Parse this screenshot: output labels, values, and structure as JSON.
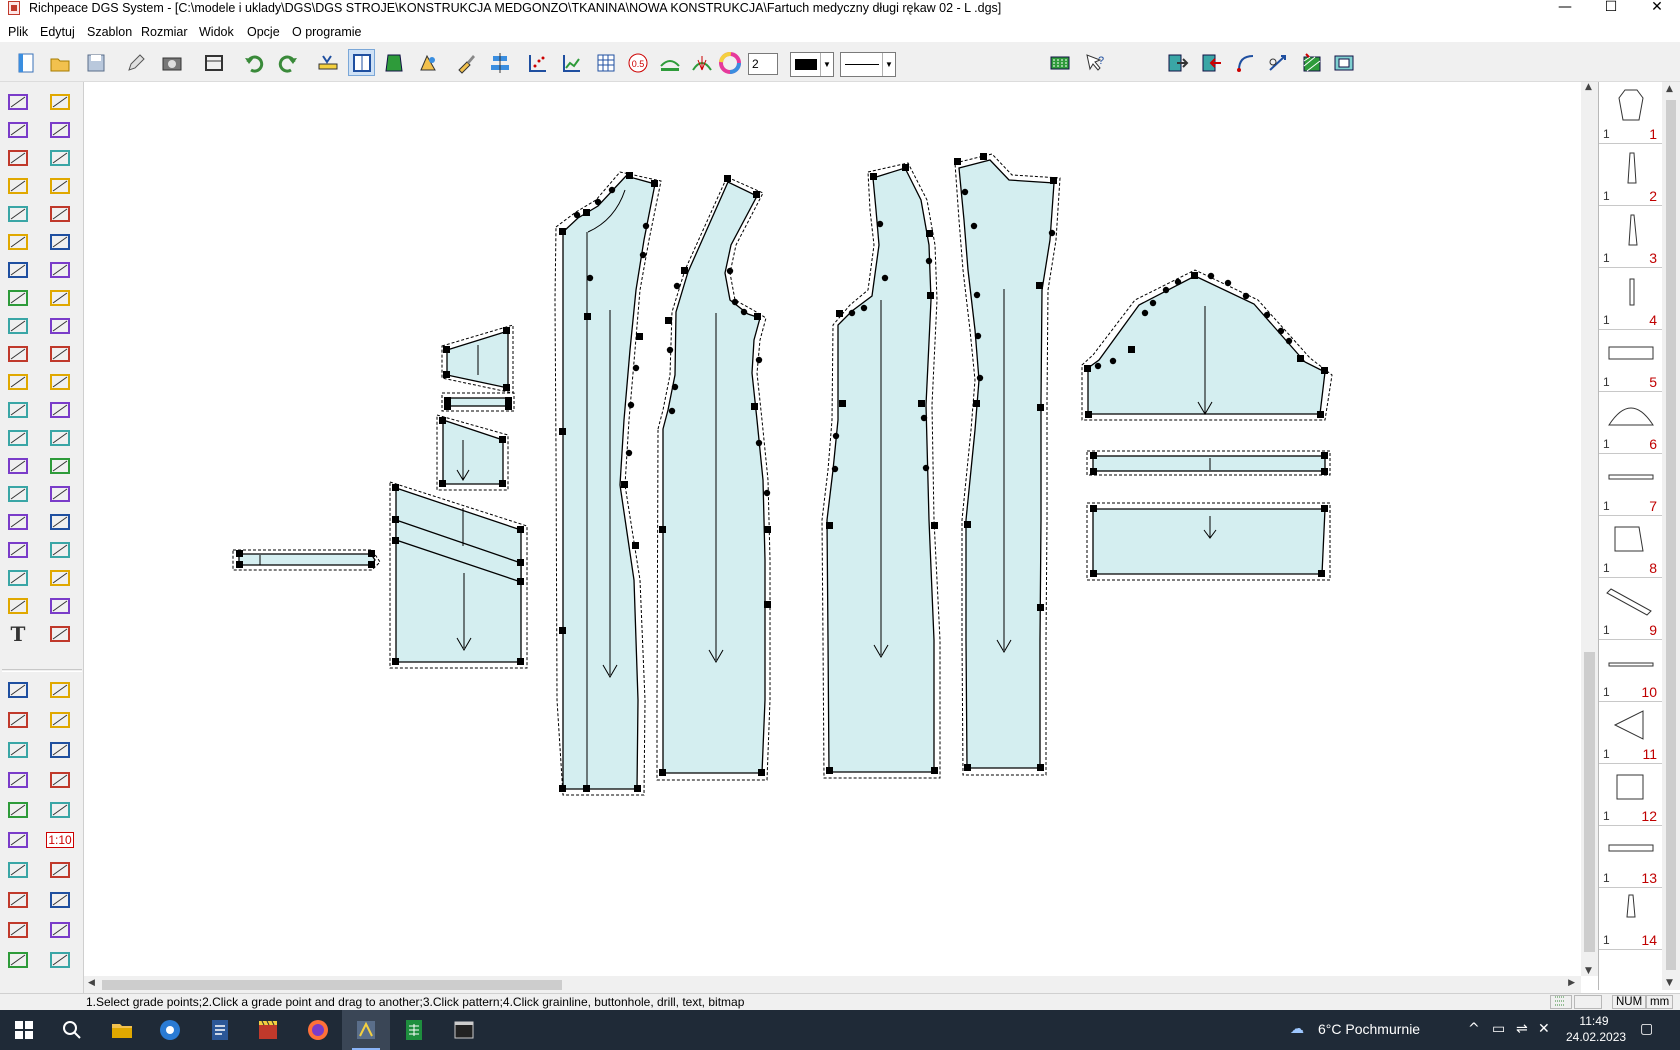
{
  "window": {
    "title": "Richpeace DGS System - [C:\\modele i uklady\\DGS\\DGS STROJE\\KONSTRUKCJA MEDGONZO\\TKANINA\\NOWA KONSTRUKCJA\\Fartuch medyczny długi rękaw 02 -  L .dgs]",
    "minimize": "—",
    "maximize": "☐",
    "close": "✕"
  },
  "menu": [
    "Plik",
    "Edytuj",
    "Szablon",
    "Rozmiar",
    "Widok",
    "Opcje",
    "O programie"
  ],
  "toolbar": {
    "line_width_value": "2",
    "pen_color": "#000000",
    "icons": [
      "new-file-icon",
      "open-folder-icon",
      "save-icon",
      "edit-pencil-icon",
      "camera-icon",
      "print-frame-icon",
      "undo-icon",
      "redo-icon",
      "ruler-grade-icon",
      "pattern-view-icon",
      "fill-piece-icon",
      "piece-tools-icon",
      "brush-icon",
      "align-icon",
      "grade-points-icon",
      "curve-chart-icon",
      "grid-table-icon",
      "scale-0-5-icon",
      "measure-curve-icon",
      "fan-curve-icon",
      "color-wheel-icon",
      "marker-icon",
      "help-icon",
      "export-icon",
      "import-icon",
      "curve-tool-icon",
      "rotate-tool-icon",
      "hatch-icon",
      "frame-icon"
    ]
  },
  "left_tools": {
    "icons": [
      "select-arrow-icon",
      "select-box-icon",
      "pencil-icon",
      "pocket-icon",
      "rectangle-icon",
      "notch-icon",
      "point-line-icon",
      "fold-icon",
      "cross-point-icon",
      "duplicate-piece-icon",
      "link-icon",
      "measure-icon",
      "compass-icon",
      "button-icon",
      "scissors-icon",
      "grid-piece-icon",
      "ruler-icon",
      "rotate-piece-icon",
      "bag-icon",
      "sew-icon",
      "book-icon",
      "dart-icon",
      "grade-icon",
      "paint-bucket-icon",
      "flare-icon",
      "split-icon",
      "spiral-icon",
      "transfer-icon",
      "dart-rotate-icon",
      "mirror-icon",
      "bridge-icon",
      "stretch-icon",
      "scissors-cut-icon",
      "pleat-icon",
      "dashed-line-icon",
      "seam-icon",
      "list-icon",
      "fill-pattern-icon",
      "text-tool-icon",
      "pleat-fan-icon"
    ],
    "icons2": [
      "parallelogram-icon",
      "protractor-icon",
      "trapezoid-icon",
      "curve-edit-icon",
      "angle-icon",
      "measure-angle-icon",
      "square-point-icon",
      "arc-icon",
      "symmetry-icon",
      "piece-arrow-icon",
      "h-line-icon",
      "scale-1-10-icon",
      "double-line-icon",
      "label-tag-icon",
      "step-line-icon",
      "outline-piece-icon",
      "node-line-icon",
      "smooth-curve-icon",
      "triangle-ruler-icon",
      "table-icon"
    ],
    "scale_label": "1:10",
    "text_tool_label": "T"
  },
  "canvas": {
    "fill_color": "#d4eef0",
    "pieces": [
      "front-piece",
      "front-side-piece",
      "back-side-piece",
      "back-piece",
      "sleeve-piece",
      "cuff-strip-piece",
      "cuff-piece",
      "pocket-piece",
      "pocket-top-piece",
      "small-pocket-piece",
      "collar-piece",
      "belt-strip-piece"
    ]
  },
  "piece_panel": {
    "items": [
      {
        "qty": "1",
        "num": "1"
      },
      {
        "qty": "1",
        "num": "2"
      },
      {
        "qty": "1",
        "num": "3"
      },
      {
        "qty": "1",
        "num": "4"
      },
      {
        "qty": "1",
        "num": "5"
      },
      {
        "qty": "1",
        "num": "6"
      },
      {
        "qty": "1",
        "num": "7"
      },
      {
        "qty": "1",
        "num": "8"
      },
      {
        "qty": "1",
        "num": "9"
      },
      {
        "qty": "1",
        "num": "10"
      },
      {
        "qty": "1",
        "num": "11"
      },
      {
        "qty": "1",
        "num": "12"
      },
      {
        "qty": "1",
        "num": "13"
      },
      {
        "qty": "1",
        "num": "14"
      }
    ]
  },
  "status": {
    "message": "1.Select grade points;2.Click a grade point and drag to another;3.Click pattern;4.Click grainline, buttonhole, drill, text, bitmap",
    "num": "NUM",
    "unit": "mm"
  },
  "taskbar": {
    "weather": "6°C  Pochmurnie",
    "time": "11:49",
    "date": "24.02.2023"
  }
}
